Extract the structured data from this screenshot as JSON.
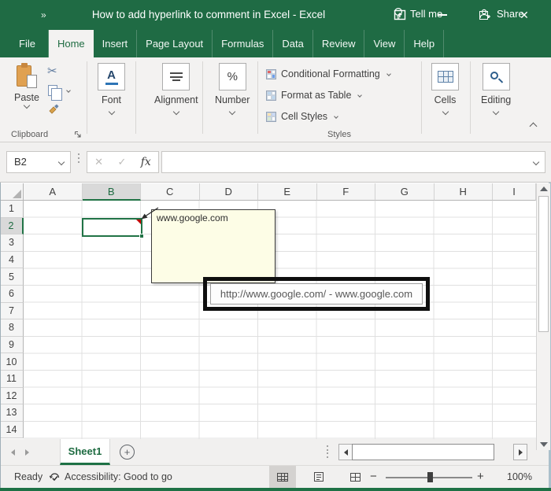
{
  "titlebar": {
    "overflow": "»",
    "title": "How to add hyperlink to comment in Excel - Excel"
  },
  "ribbon_tabs": {
    "active": "Home",
    "items": [
      "File",
      "Home",
      "Insert",
      "Page Layout",
      "Formulas",
      "Data",
      "Review",
      "View",
      "Help"
    ],
    "tell_me": "Tell me",
    "share": "Share"
  },
  "ribbon": {
    "paste_label": "Paste",
    "clipboard_group_label": "Clipboard",
    "font_label": "Font",
    "font_icon_letter": "A",
    "alignment_label": "Alignment",
    "number_label": "Number",
    "number_icon": "%",
    "styles_items": [
      "Conditional Formatting",
      "Format as Table",
      "Cell Styles"
    ],
    "styles_group_label": "Styles",
    "cells_label": "Cells",
    "editing_label": "Editing"
  },
  "formula_bar": {
    "name_box_value": "B2",
    "cancel_glyph": "✕",
    "enter_glyph": "✓",
    "fx_label": "fx",
    "formula_value": ""
  },
  "grid": {
    "columns": [
      "A",
      "B",
      "C",
      "D",
      "E",
      "F",
      "G",
      "H",
      "I"
    ],
    "rows": [
      "1",
      "2",
      "3",
      "4",
      "5",
      "6",
      "7",
      "8",
      "9",
      "10",
      "11",
      "12",
      "13",
      "14"
    ],
    "selected_cell": "B2",
    "comment_text": "www.google.com",
    "tooltip_text": "http://www.google.com/ - www.google.com"
  },
  "sheet_bar": {
    "sheet_name": "Sheet1",
    "add_sheet_glyph": "+"
  },
  "status_bar": {
    "mode": "Ready",
    "accessibility": "Accessibility: Good to go",
    "zoom_out_glyph": "−",
    "zoom_in_glyph": "+",
    "zoom_level": "100%"
  },
  "icons": {
    "cut_glyph": "✂",
    "close_glyph": "✕"
  },
  "colors": {
    "excel_green": "#217346",
    "titlebar_green": "#1F6B44",
    "comment_bg": "#FDFDE6",
    "annotation_border": "#0F0F0F",
    "selection_border": "#217346",
    "comment_indicator_red": "#C00000"
  }
}
